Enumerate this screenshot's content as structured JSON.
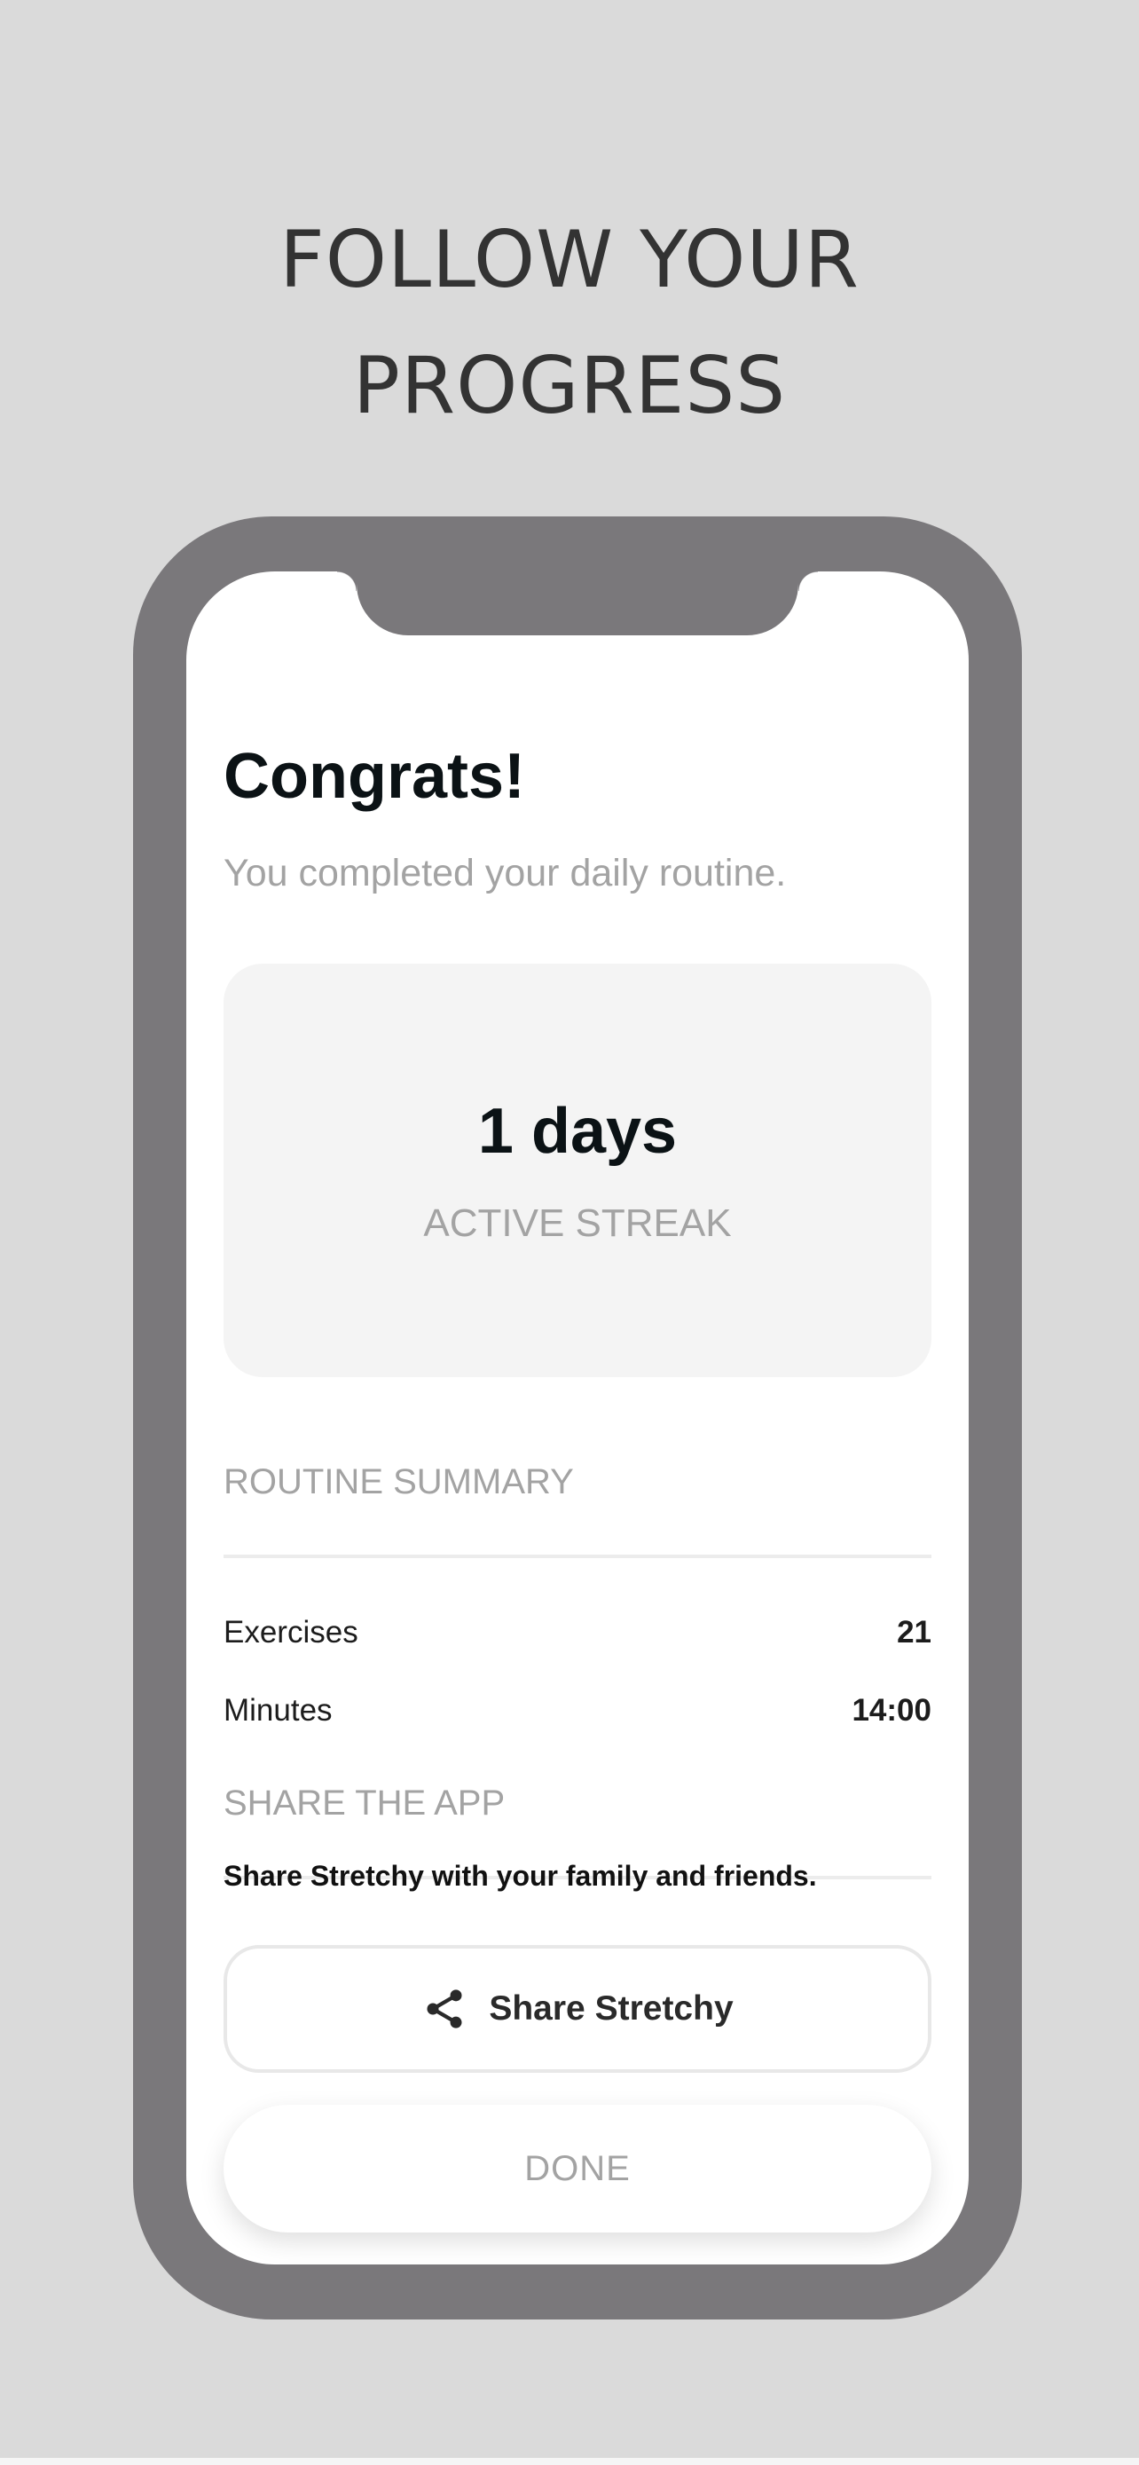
{
  "promo": {
    "headline_line1": "FOLLOW YOUR",
    "headline_line2": "PROGRESS"
  },
  "screen": {
    "title": "Congrats!",
    "subtitle": "You completed your daily routine.",
    "streak": {
      "value": "1 days",
      "label": "ACTIVE STREAK"
    },
    "routine_summary": {
      "header": "ROUTINE SUMMARY",
      "rows": [
        {
          "label": "Exercises",
          "value": "21"
        },
        {
          "label": "Minutes",
          "value": "14:00"
        }
      ]
    },
    "share": {
      "header": "SHARE THE APP",
      "text": "Share Stretchy with your family and friends.",
      "button_label": "Share Stretchy",
      "button_icon": "share-icon"
    },
    "done_label": "DONE"
  },
  "colors": {
    "background": "#dadada",
    "phone_frame": "#7a787b",
    "title_text": "#0b1215",
    "muted_text": "#a3a3a3",
    "card_background": "#f4f4f4"
  }
}
